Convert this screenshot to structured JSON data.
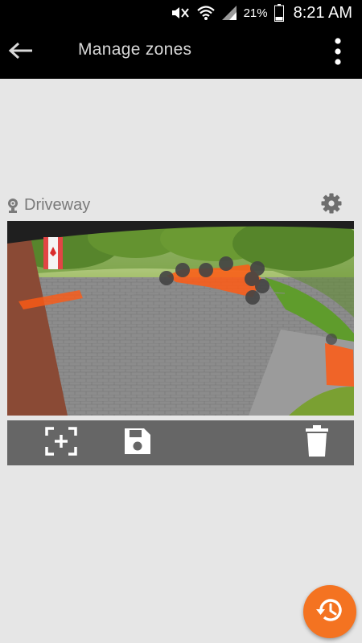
{
  "status_bar": {
    "battery_percent": "21%",
    "time": "8:21 AM",
    "icons": [
      "mute-icon",
      "wifi-icon",
      "signal-icon",
      "battery-icon"
    ]
  },
  "app_bar": {
    "title": "Manage zones",
    "back_icon": "arrow-left-icon",
    "menu_icon": "more-vert-icon"
  },
  "camera": {
    "name": "Driveway",
    "camera_icon": "camera-icon",
    "settings_icon": "gear-icon"
  },
  "toolbar": {
    "items": [
      "add-zone-icon",
      "save-icon",
      "delete-icon"
    ]
  },
  "fab": {
    "icon": "history-icon"
  },
  "colors": {
    "accent": "#f47321",
    "zone": "#ff5a14",
    "toolbar": "#666666",
    "app_bar": "#000000",
    "background": "#e6e6e6"
  }
}
